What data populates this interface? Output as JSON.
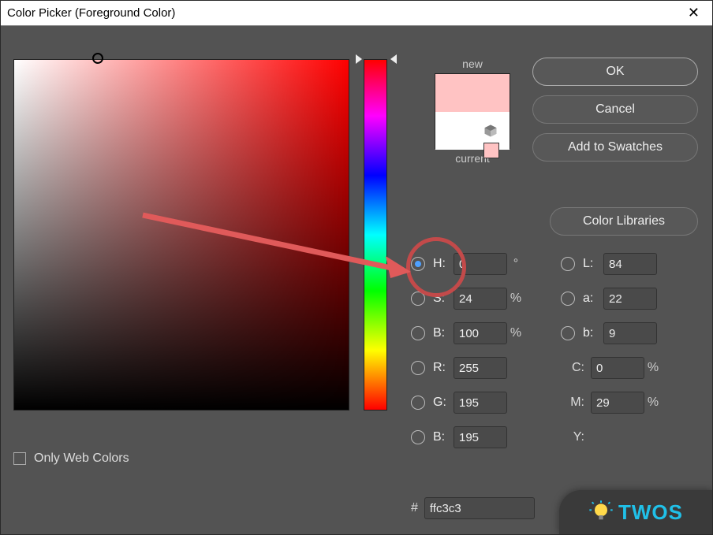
{
  "window": {
    "title": "Color Picker (Foreground Color)"
  },
  "buttons": {
    "ok": "OK",
    "cancel": "Cancel",
    "add_swatches": "Add to Swatches",
    "libraries": "Color Libraries"
  },
  "preview": {
    "new_label": "new",
    "current_label": "current",
    "new_color": "#ffc3c3",
    "current_color": "#ffffff",
    "mini_swatch": "#ffc3c3"
  },
  "fields": {
    "H": {
      "label": "H:",
      "value": "0",
      "unit": "°"
    },
    "S": {
      "label": "S:",
      "value": "24",
      "unit": "%"
    },
    "Bhsb": {
      "label": "B:",
      "value": "100",
      "unit": "%"
    },
    "R": {
      "label": "R:",
      "value": "255"
    },
    "G": {
      "label": "G:",
      "value": "195"
    },
    "Brgb": {
      "label": "B:",
      "value": "195"
    },
    "L": {
      "label": "L:",
      "value": "84"
    },
    "a": {
      "label": "a:",
      "value": "22"
    },
    "b": {
      "label": "b:",
      "value": "9"
    },
    "C": {
      "label": "C:",
      "value": "0",
      "unit": "%"
    },
    "M": {
      "label": "M:",
      "value": "29",
      "unit": "%"
    },
    "Y": {
      "label": "Y:",
      "value": "",
      "unit": "%"
    }
  },
  "hex": {
    "label": "#",
    "value": "ffc3c3"
  },
  "web_only": {
    "label": "Only Web Colors"
  },
  "watermark": {
    "text": "TWOS"
  }
}
